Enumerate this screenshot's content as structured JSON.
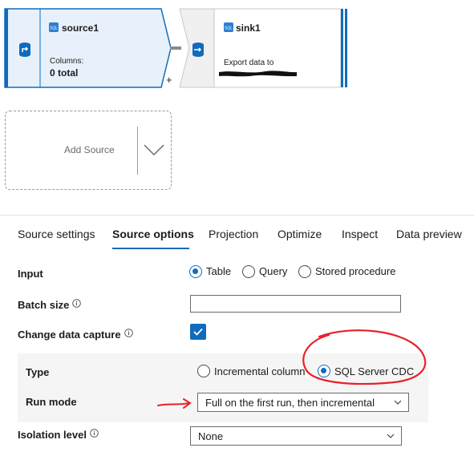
{
  "canvas": {
    "source_node": {
      "name": "source1",
      "columns_label": "Columns:",
      "columns_value": "0 total"
    },
    "sink_node": {
      "name": "sink1",
      "description": "Export data to"
    },
    "add_button": "+",
    "add_source": {
      "label": "Add Source"
    }
  },
  "tabs": [
    {
      "label": "Source settings",
      "active": false
    },
    {
      "label": "Source options",
      "active": true
    },
    {
      "label": "Projection",
      "active": false
    },
    {
      "label": "Optimize",
      "active": false
    },
    {
      "label": "Inspect",
      "active": false
    },
    {
      "label": "Data preview",
      "active": false
    }
  ],
  "form": {
    "input": {
      "label": "Input",
      "options": [
        "Table",
        "Query",
        "Stored procedure"
      ],
      "selected": "Table"
    },
    "batch_size": {
      "label": "Batch size",
      "value": ""
    },
    "change_data_capture": {
      "label": "Change data capture",
      "checked": true
    },
    "type": {
      "label": "Type",
      "options": [
        "Incremental column",
        "SQL Server CDC"
      ],
      "selected": "SQL Server CDC"
    },
    "run_mode": {
      "label": "Run mode",
      "value": "Full on the first run, then incremental"
    },
    "isolation_level": {
      "label": "Isolation level",
      "value": "None"
    }
  },
  "colors": {
    "accent": "#0f6cbd",
    "annotation": "#e8202a",
    "node_fill": "#e8f1fb"
  },
  "icons": [
    "source-icon",
    "sink-icon",
    "sql-icon",
    "info-icon",
    "chevron-down-icon",
    "checkmark-icon"
  ]
}
